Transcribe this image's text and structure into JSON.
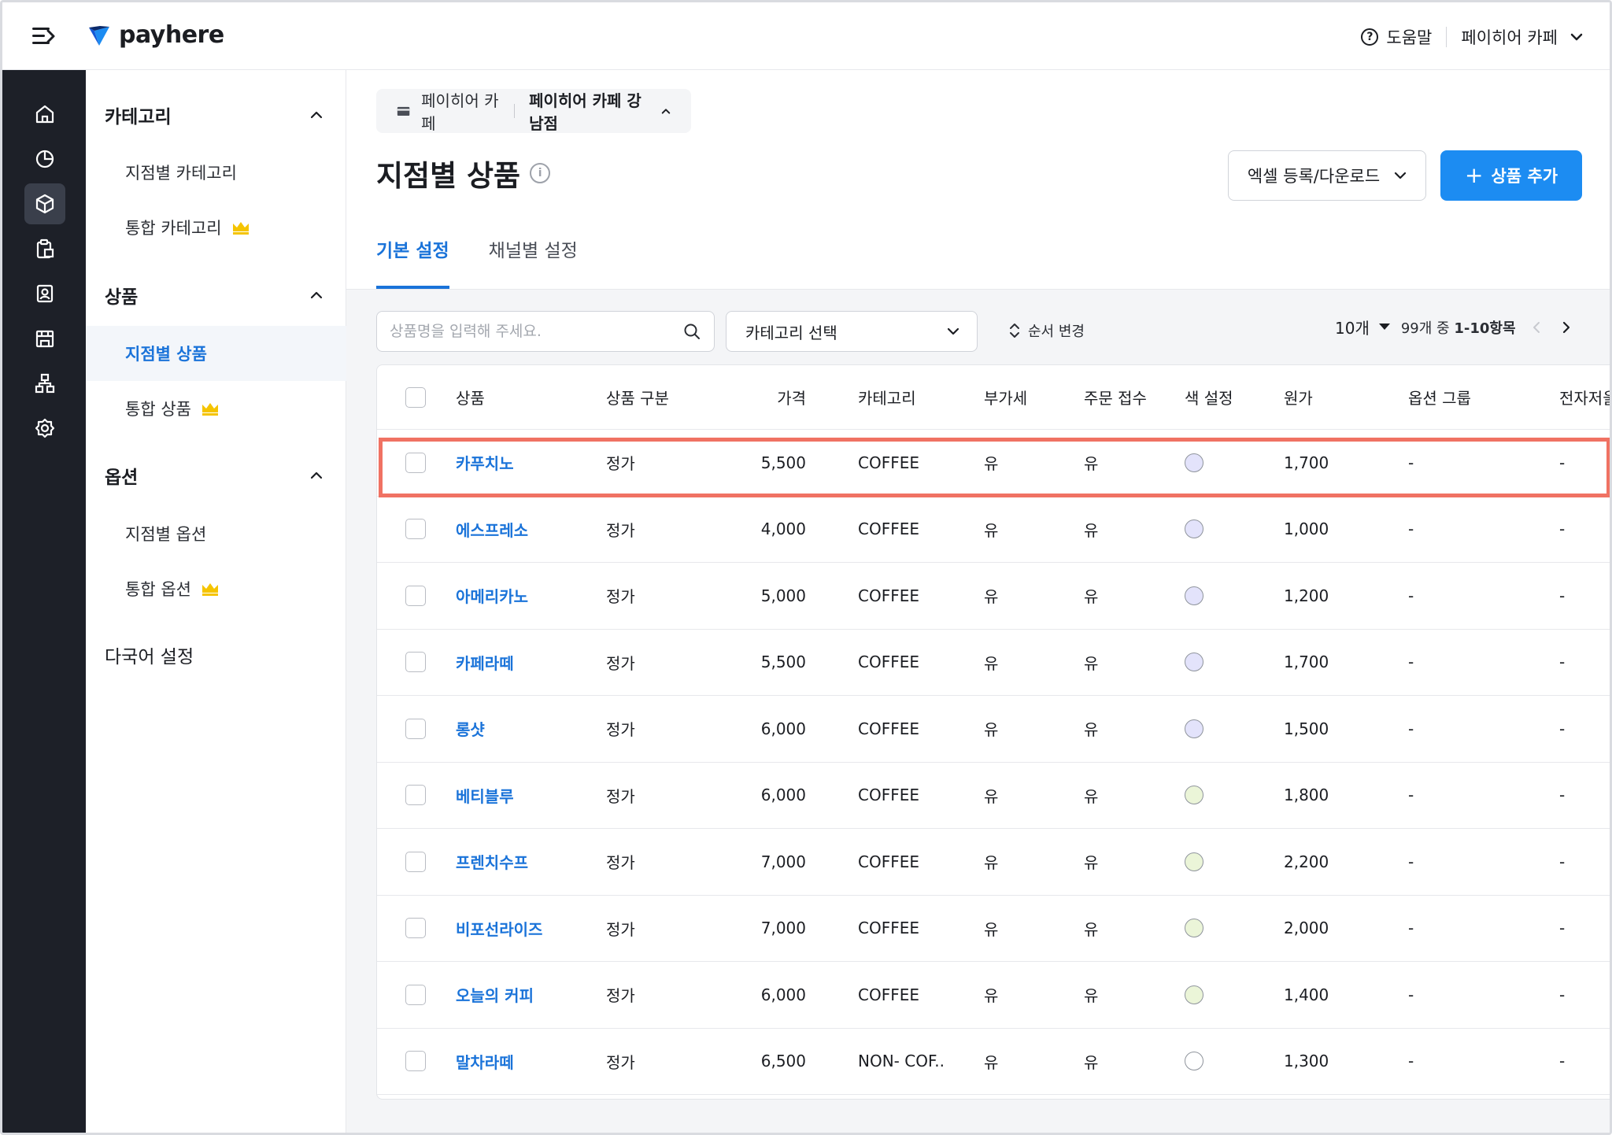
{
  "brand": {
    "name": "payhere",
    "accent": "#1c8cf2",
    "highlight": "#f07263"
  },
  "header": {
    "help_label": "도움말",
    "store_label": "페이히어 카페"
  },
  "rail": [
    "home-icon",
    "chart-icon",
    "box-icon",
    "clipboard-icon",
    "user-card-icon",
    "store-icon",
    "org-icon",
    "gear-icon"
  ],
  "subnav": {
    "category_title": "카테고리",
    "category_items": [
      "지점별 카테고리",
      "통합 카테고리"
    ],
    "product_title": "상품",
    "product_items": [
      "지점별 상품",
      "통합 상품"
    ],
    "option_title": "옵션",
    "option_items": [
      "지점별 옵션",
      "통합 옵션"
    ],
    "language_title": "다국어 설정"
  },
  "breadcrumb": {
    "brand": "페이히어 카페",
    "branch": "페이히어 카페 강남점"
  },
  "page": {
    "title": "지점별 상품",
    "excel_label": "엑셀 등록/다운로드",
    "add_label": "상품 추가",
    "add_plus": "+"
  },
  "tabs": [
    "기본 설정",
    "채널별 설정"
  ],
  "toolbar": {
    "search_placeholder": "상품명을 입력해 주세요.",
    "category_label": "카테고리 선택",
    "sort_label": "순서 변경",
    "per_page": "10개",
    "range_prefix": "99개 중",
    "range_value": "1-10항목"
  },
  "columns": [
    "상품",
    "상품 구분",
    "가격",
    "카테고리",
    "부가세",
    "주문 접수",
    "색 설정",
    "원가",
    "옵션 그룹",
    "전자저울"
  ],
  "rows": [
    {
      "name": "카푸치노",
      "type": "정가",
      "price": "5,500",
      "category": "COFFEE",
      "vat": "유",
      "order": "유",
      "color": "#e3e3fb",
      "cost": "1,700",
      "option_group": "-",
      "scale": "-"
    },
    {
      "name": "에스프레소",
      "type": "정가",
      "price": "4,000",
      "category": "COFFEE",
      "vat": "유",
      "order": "유",
      "color": "#e3e3fb",
      "cost": "1,000",
      "option_group": "-",
      "scale": "-"
    },
    {
      "name": "아메리카노",
      "type": "정가",
      "price": "5,000",
      "category": "COFFEE",
      "vat": "유",
      "order": "유",
      "color": "#e3e3fb",
      "cost": "1,200",
      "option_group": "-",
      "scale": "-"
    },
    {
      "name": "카페라떼",
      "type": "정가",
      "price": "5,500",
      "category": "COFFEE",
      "vat": "유",
      "order": "유",
      "color": "#e3e3fb",
      "cost": "1,700",
      "option_group": "-",
      "scale": "-"
    },
    {
      "name": "롱샷",
      "type": "정가",
      "price": "6,000",
      "category": "COFFEE",
      "vat": "유",
      "order": "유",
      "color": "#e3e3fb",
      "cost": "1,500",
      "option_group": "-",
      "scale": "-"
    },
    {
      "name": "베티블루",
      "type": "정가",
      "price": "6,000",
      "category": "COFFEE",
      "vat": "유",
      "order": "유",
      "color": "#ebf5d8",
      "cost": "1,800",
      "option_group": "-",
      "scale": "-"
    },
    {
      "name": "프렌치수프",
      "type": "정가",
      "price": "7,000",
      "category": "COFFEE",
      "vat": "유",
      "order": "유",
      "color": "#ebf5d8",
      "cost": "2,200",
      "option_group": "-",
      "scale": "-"
    },
    {
      "name": "비포선라이즈",
      "type": "정가",
      "price": "7,000",
      "category": "COFFEE",
      "vat": "유",
      "order": "유",
      "color": "#ebf5d8",
      "cost": "2,000",
      "option_group": "-",
      "scale": "-"
    },
    {
      "name": "오늘의 커피",
      "type": "정가",
      "price": "6,000",
      "category": "COFFEE",
      "vat": "유",
      "order": "유",
      "color": "#ebf5d8",
      "cost": "1,400",
      "option_group": "-",
      "scale": "-"
    },
    {
      "name": "말차라떼",
      "type": "정가",
      "price": "6,500",
      "category": "NON- COF..",
      "vat": "유",
      "order": "유",
      "color": "#ffffff",
      "cost": "1,300",
      "option_group": "-",
      "scale": "-"
    }
  ]
}
